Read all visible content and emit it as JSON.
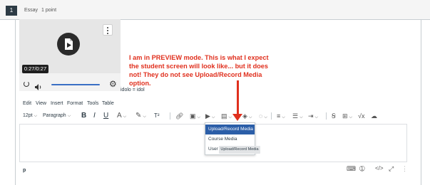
{
  "question": {
    "number": "1",
    "type": "Essay",
    "points": "1 point"
  },
  "player": {
    "time": "0:27/0:27",
    "progress_fraction": 1.0,
    "icons": [
      "more-options-icon",
      "video-file-icon",
      "replay-icon",
      "volume-icon",
      "settings-gear-icon"
    ]
  },
  "caption": "idolo = idol",
  "annotation": "I am in PREVIEW mode. This is what I expect the student screen will look like... but it does not! They do not see Upload/Record Media option.",
  "menubar": [
    "Edit",
    "View",
    "Insert",
    "Format",
    "Tools",
    "Table"
  ],
  "toolbar": {
    "font_size": "12pt",
    "block_format": "Paragraph",
    "bold": "B",
    "italic": "I",
    "underline": "U",
    "superscript": "T²"
  },
  "dropdown": {
    "items": [
      "Upload/Record Media",
      "Course Media",
      "User"
    ],
    "selected": "Upload/Record Media",
    "tooltip": "Upload/Record Media"
  },
  "statusbar": {
    "path": "p"
  },
  "colors": {
    "annotation": "#e0301e",
    "accent": "#2b5ea8",
    "text": "#2d3b45"
  }
}
